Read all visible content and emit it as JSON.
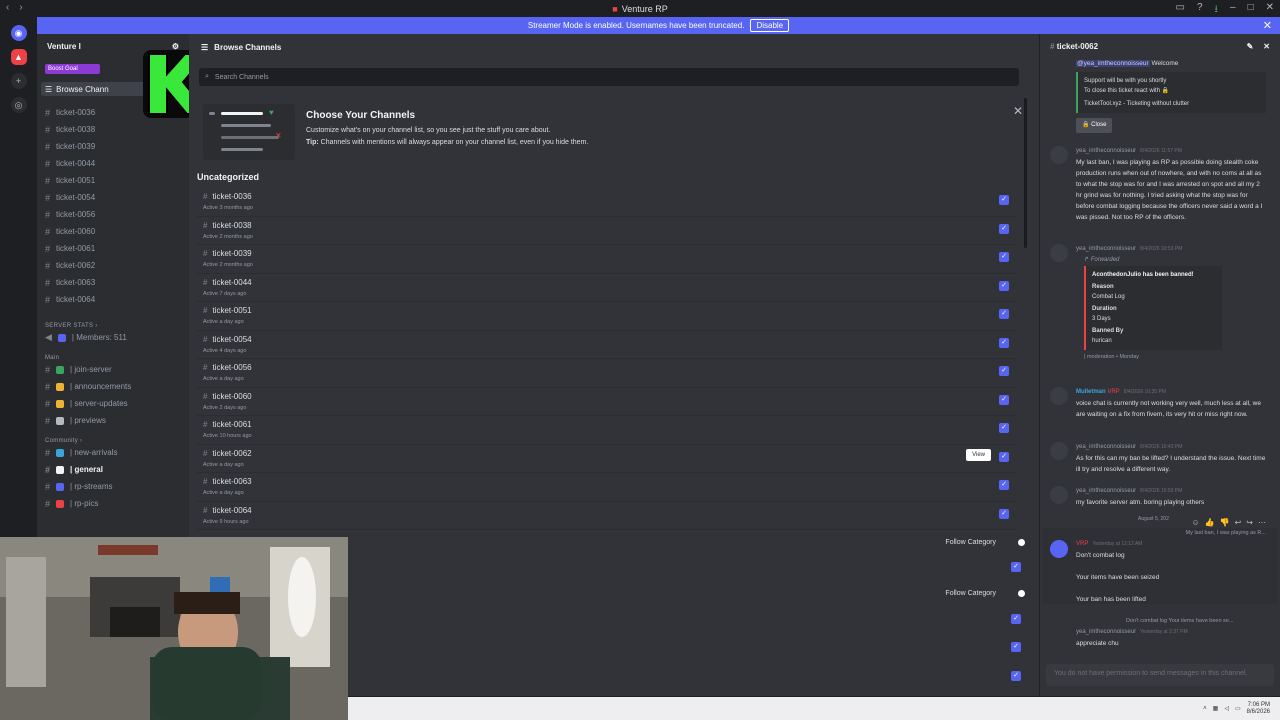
{
  "titlebar": {
    "title": "Venture RP"
  },
  "banner": {
    "text": "Streamer Mode is enabled. Usernames have been truncated.",
    "disable_label": "Disable"
  },
  "sidebar": {
    "server_name": "Venture I",
    "boost_label": "Boost Goal",
    "browse_label": "Browse Chann",
    "tickets": [
      "ticket-0036",
      "ticket-0038",
      "ticket-0039",
      "ticket-0044",
      "ticket-0051",
      "ticket-0054",
      "ticket-0056",
      "ticket-0060",
      "ticket-0061",
      "ticket-0062",
      "ticket-0063",
      "ticket-0064"
    ],
    "server_stats_label": "SERVER STATS",
    "members_label": "| Members: 511",
    "main_label": "Main",
    "main_channels": [
      "| join-server",
      "| announcements",
      "| server-updates",
      "| previews"
    ],
    "community_label": "Community",
    "community_channels": [
      "| new-arrivals",
      "| general",
      "| rp-streams",
      "| rp-pics"
    ]
  },
  "main": {
    "title": "Browse Channels",
    "search_placeholder": "Search Channels",
    "choose_title": "Choose Your Channels",
    "choose_desc": "Customize what's on your channel list, so you see just the stuff you care about.",
    "tip_label": "Tip:",
    "tip_text": "Channels with mentions will always appear on your channel list, even if you hide them.",
    "category": "Uncategorized",
    "rows": [
      {
        "name": "ticket-0036",
        "active": "Active 3 months ago"
      },
      {
        "name": "ticket-0038",
        "active": "Active 2 months ago"
      },
      {
        "name": "ticket-0039",
        "active": "Active 2 months ago"
      },
      {
        "name": "ticket-0044",
        "active": "Active 7 days ago"
      },
      {
        "name": "ticket-0051",
        "active": "Active a day ago"
      },
      {
        "name": "ticket-0054",
        "active": "Active 4 days ago"
      },
      {
        "name": "ticket-0056",
        "active": "Active a day ago"
      },
      {
        "name": "ticket-0060",
        "active": "Active 2 days ago"
      },
      {
        "name": "ticket-0061",
        "active": "Active 10 hours ago"
      },
      {
        "name": "ticket-0062",
        "active": "Active a day ago"
      },
      {
        "name": "ticket-0063",
        "active": "Active a day ago"
      },
      {
        "name": "ticket-0064",
        "active": "Active 9 hours ago"
      }
    ],
    "view_label": "View",
    "follow_label": "Follow Category"
  },
  "thread": {
    "title": "ticket-0062",
    "welcome_mention": "@yea_imtheconnoisseur",
    "welcome_word": "Welcome",
    "support_line1": "Support will be with you shortly",
    "support_line2": "To close this ticket react with",
    "tickettool": "TicketTool.xyz - Ticketing without clutter",
    "close_label": "Close",
    "msg1_author": "yea_imtheconnoisseur",
    "msg1_time": "8/4/2026 11:57 PM",
    "msg1_text": "My last ban, I was playing as RP as possible doing stealth coke production runs when out of nowhere, and with no coms at all as to what the stop was for and I was arrested on spot and all my 2 hr grind was for nothing. I tried asking what the stop was for before combat logging because the officers never said a word a I was pissed. Not too RP of the officers.",
    "msg2_author": "yea_imtheconnoisseur",
    "msg2_time": "8/4/2026 10:53 PM",
    "forwarded_label": "Forwarded",
    "ban_title": "AconthedonJulio has been banned!",
    "reason_label": "Reason",
    "reason_value": "Combat Log",
    "duration_label": "Duration",
    "duration_value": "3 Days",
    "bannedby_label": "Banned By",
    "bannedby_value": "hurican",
    "fwd_footer": "| moderation • Monday",
    "msg3_author": "Mulletman",
    "msg3_tag": "VRP",
    "msg3_time": "8/4/2026 10:35 PM",
    "msg3_text": "voice chat is currently not working very well, much less at all, we are waiting on a fix from fivem, its very hit or miss right now.",
    "msg4_author": "yea_imtheconnoisseur",
    "msg4_time": "8/4/2026 10:43 PM",
    "msg4_text": "As for this can my ban be lifted? I understand the issue. Next time ill try and resolve a different way.",
    "msg5_author": "yea_imtheconnoisseur",
    "msg5_time": "8/4/2026 10:50 PM",
    "msg5_text": "my favorite server atm. boring playing others",
    "date_divider": "August 5, 202",
    "reply_preview": "My last ban, I was playing as R...",
    "msg6_tag": "VRP",
    "msg6_time": "Yesterday at 12:12 AM",
    "msg6_line1": "Don't combat log",
    "msg6_line2": "Your items have been seized",
    "msg6_line3": "Your ban has been lifted",
    "reply2_preview": "Don't combat log  Your items have been se...",
    "msg7_author": "yea_imtheconnoisseur",
    "msg7_time": "Yesterday at 2:37 PM",
    "msg7_text": "appreciate chu",
    "no_permission": "You do not have permission to send messages in this channel."
  },
  "taskbar": {
    "time": "7:06 PM",
    "date": "8/6/2026"
  },
  "colors": {
    "accent": "#5865f2",
    "logo_green": "#39e83a",
    "boost": "#8b3ad6"
  }
}
